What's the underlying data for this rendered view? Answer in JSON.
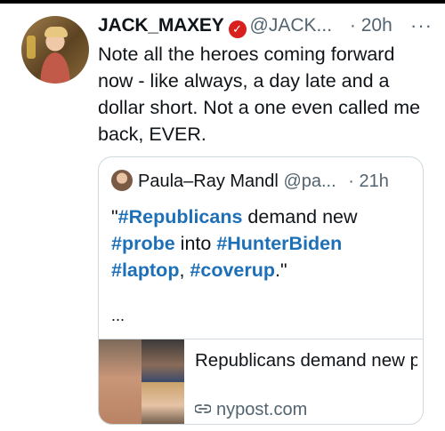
{
  "tweet": {
    "display_name": "JACK_MAXEY",
    "handle": "@JACK...",
    "separator": "·",
    "time": "20h",
    "more": "···",
    "text": "Note all the heroes coming forward now - like always, a day late and a dollar short. Not a one even called me back, EVER."
  },
  "quote": {
    "display_name": "Paula–Ray Mandl",
    "handle": "@pa...",
    "separator": "·",
    "time": "21h",
    "parts": [
      "\"",
      "#Republicans",
      " demand new ",
      "#probe",
      " into ",
      "#HunterBiden",
      " ",
      "#laptop",
      ", ",
      "#coverup",
      ".\""
    ],
    "ellipsis": "...",
    "card": {
      "title": "Republicans demand new probe into Hunter Biden...",
      "domain": "nypost.com"
    }
  },
  "colors": {
    "hashtag": "#1d6fb8",
    "verified": "#d8211f",
    "muted": "#536471"
  }
}
